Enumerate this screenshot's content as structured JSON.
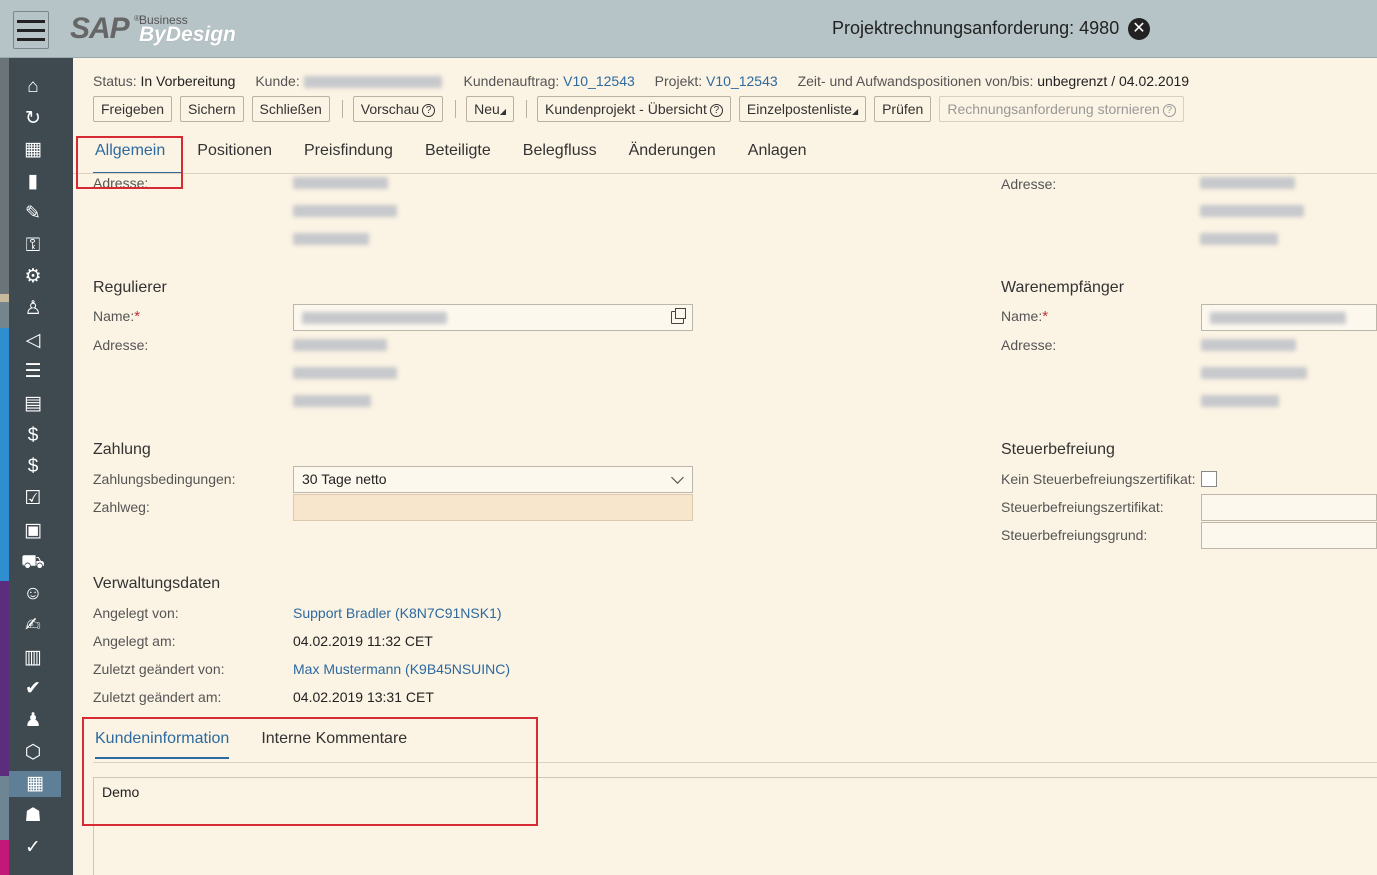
{
  "window": {
    "title": "Projektrechnungsanforderung: 4980"
  },
  "logo": {
    "brand": "SAP",
    "reg": "®",
    "line1": "Business",
    "line2": "ByDesign"
  },
  "status": {
    "status_label": "Status:",
    "status_value": "In Vorbereitung",
    "kunde_label": "Kunde:",
    "auftrag_label": "Kundenauftrag:",
    "auftrag_value": "V10_12543",
    "projekt_label": "Projekt:",
    "projekt_value": "V10_12543",
    "zeit_label": "Zeit- und Aufwandspositionen von/bis:",
    "zeit_value": "unbegrenzt / 04.02.2019"
  },
  "toolbar": {
    "freigeben": "Freigeben",
    "sichern": "Sichern",
    "schliessen": "Schließen",
    "vorschau": "Vorschau",
    "neu": "Neu",
    "kundenprojekt": "Kundenprojekt - Übersicht",
    "einzelposten": "Einzelpostenliste",
    "pruefen": "Prüfen",
    "stornieren": "Rechnungsanforderung stornieren"
  },
  "tabs": [
    "Allgemein",
    "Positionen",
    "Preisfindung",
    "Beteiligte",
    "Belegfluss",
    "Änderungen",
    "Anlagen"
  ],
  "address_label": "Adresse:",
  "name_label": "Name:",
  "regulierer": {
    "title": "Regulierer"
  },
  "warenempfaenger": {
    "title": "Warenempfänger"
  },
  "zahlung": {
    "title": "Zahlung",
    "bedingungen_label": "Zahlungsbedingungen:",
    "bedingungen_value": "30 Tage netto",
    "zahlweg_label": "Zahlweg:"
  },
  "steuer": {
    "title": "Steuerbefreiung",
    "kein_label": "Kein Steuerbefreiungszertifikat:",
    "zertifikat_label": "Steuerbefreiungszertifikat:",
    "grund_label": "Steuerbefreiungsgrund:"
  },
  "verwaltung": {
    "title": "Verwaltungsdaten",
    "angelegt_von_label": "Angelegt von:",
    "angelegt_von": "Support Bradler (K8N7C91NSK1)",
    "angelegt_am_label": "Angelegt am:",
    "angelegt_am": "04.02.2019 11:32 CET",
    "geaendert_von_label": "Zuletzt geändert von:",
    "geaendert_von": "Max Mustermann (K9B45NSUINC)",
    "geaendert_am_label": "Zuletzt geändert am:",
    "geaendert_am": "04.02.2019 13:31 CET"
  },
  "subtabs": [
    "Kundeninformation",
    "Interne Kommentare"
  ],
  "note_text": "Demo",
  "close_glyph": "✕",
  "help_glyph": "?",
  "colors": {
    "shell": "#b6c4c8",
    "content_bg": "#fbf3e3",
    "nav_bg": "#3e4a50",
    "link": "#2c6aa0",
    "highlight": "#d62b35"
  },
  "nav_icons": [
    "home-icon",
    "refresh-icon",
    "dashboard-icon",
    "analytics-icon",
    "edit-icon",
    "security-icon",
    "settings-icon",
    "org-icon",
    "campaign-icon",
    "contacts-icon",
    "card-icon",
    "document-money-icon",
    "document-money2-icon",
    "checklist-icon",
    "clipboard-icon",
    "car-icon",
    "support-icon",
    "notes-icon",
    "receipt-icon",
    "invoice-check-icon",
    "person-desk-icon",
    "boxes-icon",
    "calendar-edit-icon",
    "group-icon",
    "user-check-icon"
  ]
}
